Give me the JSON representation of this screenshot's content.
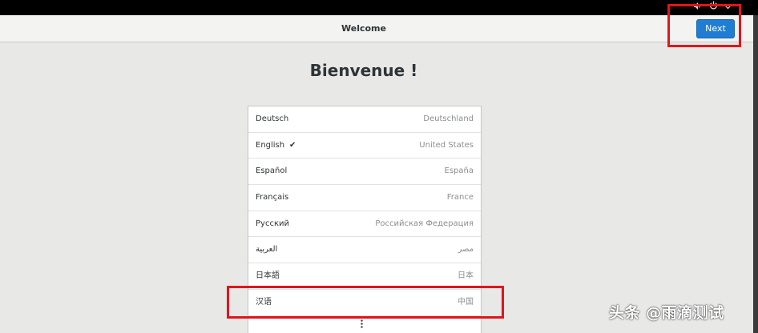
{
  "system_bar": {
    "icons": [
      "volume-icon",
      "power-icon",
      "chevron-down-icon"
    ]
  },
  "header": {
    "title": "Welcome",
    "next_label": "Next"
  },
  "main": {
    "heading": "Bienvenue !",
    "languages": [
      {
        "name": "Deutsch",
        "region": "Deutschland",
        "selected": false
      },
      {
        "name": "English",
        "region": "United States",
        "selected": true
      },
      {
        "name": "Español",
        "region": "España",
        "selected": false
      },
      {
        "name": "Français",
        "region": "France",
        "selected": false
      },
      {
        "name": "Русский",
        "region": "Российская Федерация",
        "selected": false
      },
      {
        "name": "العربية",
        "region": "مصر",
        "selected": false
      },
      {
        "name": "日本語",
        "region": "日本",
        "selected": false
      },
      {
        "name": "汉语",
        "region": "中国",
        "selected": false
      }
    ],
    "more_icon": "more-vertical-icon"
  },
  "watermark": "头条 @雨滴测试",
  "colors": {
    "accent": "#1f7ed3",
    "annotation": "#e3141b"
  }
}
